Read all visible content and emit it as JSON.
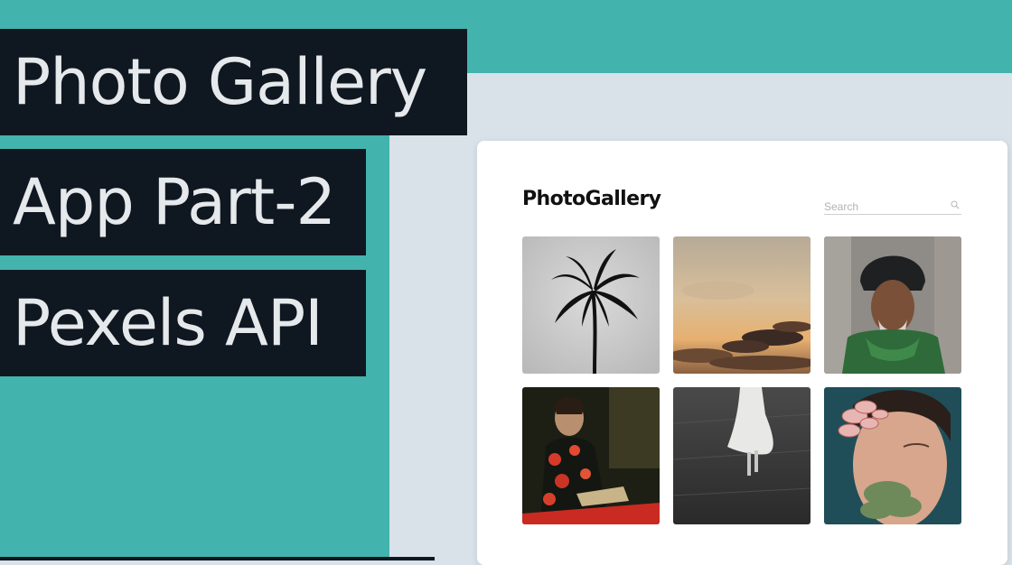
{
  "thumbnail": {
    "title_lines": [
      "Photo Gallery",
      "App Part-2",
      "Pexels API"
    ],
    "colors": {
      "teal": "#43b3ad",
      "title_bg": "#0f1721",
      "title_text": "#e6e9ec",
      "page_bg": "#d9e1e9"
    }
  },
  "app": {
    "brand": "PhotoGallery",
    "search": {
      "placeholder": "Search",
      "value": "",
      "icon": "search-icon"
    },
    "photos": [
      {
        "subject": "palm tree silhouette"
      },
      {
        "subject": "sunset clouds"
      },
      {
        "subject": "man in turban and green scarf"
      },
      {
        "subject": "woman in floral dress reading"
      },
      {
        "subject": "woman in white dress walking"
      },
      {
        "subject": "face with rose petals"
      }
    ]
  }
}
